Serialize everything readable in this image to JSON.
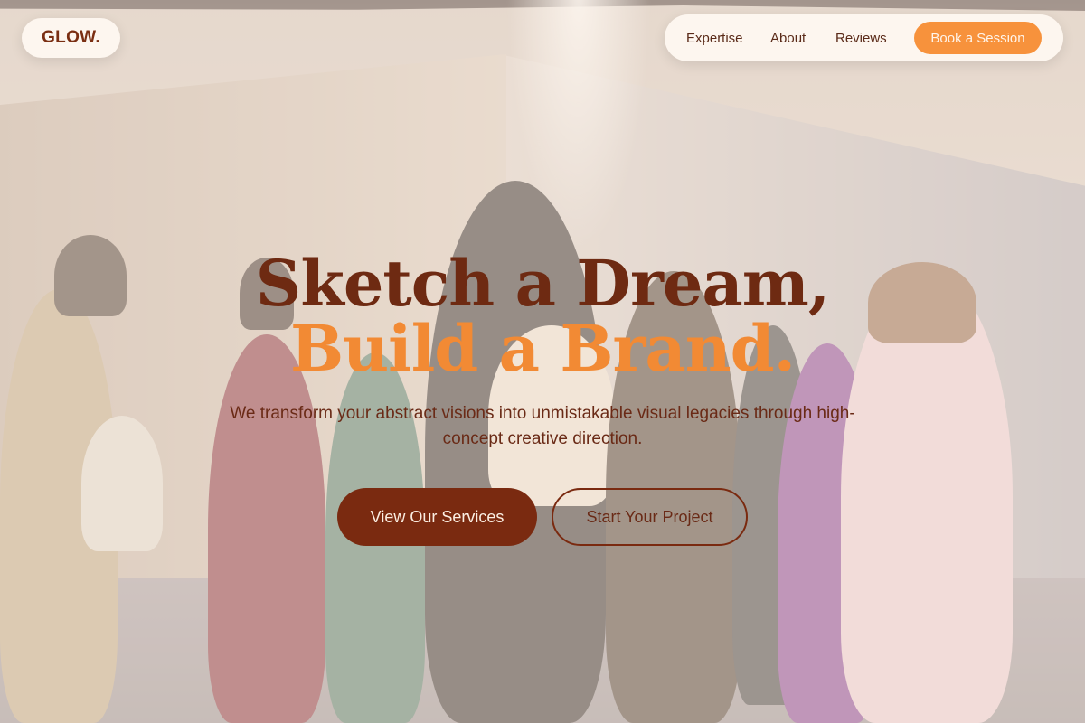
{
  "brand": {
    "logo": "GLOW."
  },
  "nav": {
    "links": [
      "Expertise",
      "About",
      "Reviews"
    ],
    "cta_label": "Book a Session"
  },
  "hero": {
    "headline_line1": "Sketch a Dream,",
    "headline_line2": "Build a Brand.",
    "subtitle": "We transform your abstract visions into unmistakable visual legacies through high-concept creative direction.",
    "primary_cta": "View Our Services",
    "secondary_cta": "Start Your Project",
    "background_image": "fashion-group-photo"
  },
  "colors": {
    "brand_dark": "#7a2a10",
    "accent_orange": "#f7923c",
    "pill_bg": "#fdf6ef"
  }
}
